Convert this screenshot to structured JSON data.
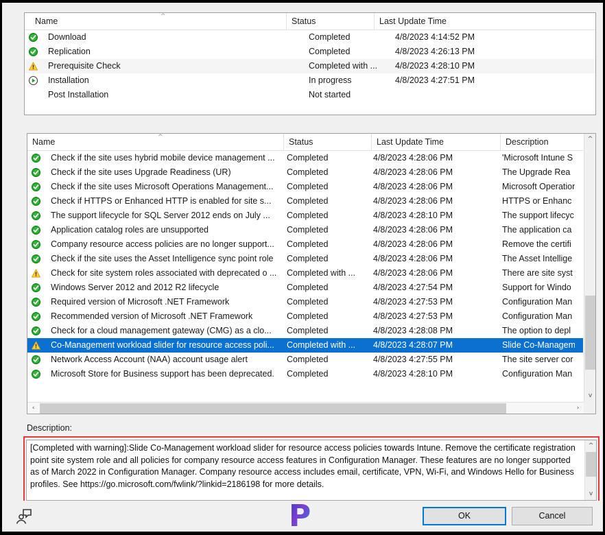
{
  "top_panel": {
    "columns": [
      "Name",
      "Status",
      "Last Update Time"
    ],
    "sort_indicator": "^",
    "rows": [
      {
        "icon": "success-icon",
        "name": "Download",
        "status": "Completed",
        "time": "4/8/2023 4:14:52 PM"
      },
      {
        "icon": "success-icon",
        "name": "Replication",
        "status": "Completed",
        "time": "4/8/2023 4:26:13 PM"
      },
      {
        "icon": "warning-icon",
        "name": "Prerequisite Check",
        "status": "Completed with ...",
        "time": "4/8/2023 4:28:10 PM"
      },
      {
        "icon": "progress-icon",
        "name": "Installation",
        "status": "In progress",
        "time": "4/8/2023 4:27:51 PM"
      },
      {
        "icon": "none",
        "name": "Post Installation",
        "status": "Not started",
        "time": ""
      }
    ]
  },
  "main_panel": {
    "columns": [
      "Name",
      "Status",
      "Last Update Time",
      "Description"
    ],
    "sort_indicator": "^",
    "rows": [
      {
        "icon": "success-icon",
        "name": "Check if the site uses hybrid mobile device management ...",
        "status": "Completed",
        "time": "4/8/2023 4:28:06 PM",
        "description": "'Microsoft Intune S"
      },
      {
        "icon": "success-icon",
        "name": "Check if the site uses Upgrade Readiness (UR)",
        "status": "Completed",
        "time": "4/8/2023 4:28:06 PM",
        "description": "The Upgrade Rea"
      },
      {
        "icon": "success-icon",
        "name": "Check if the site uses Microsoft Operations Management...",
        "status": "Completed",
        "time": "4/8/2023 4:28:06 PM",
        "description": "Microsoft Operation"
      },
      {
        "icon": "success-icon",
        "name": "Check if HTTPS or Enhanced HTTP is enabled for site s...",
        "status": "Completed",
        "time": "4/8/2023 4:28:06 PM",
        "description": "HTTPS or Enhanc"
      },
      {
        "icon": "success-icon",
        "name": "The support lifecycle for SQL Server 2012 ends on July ...",
        "status": "Completed",
        "time": "4/8/2023 4:28:10 PM",
        "description": "The support lifecyc"
      },
      {
        "icon": "success-icon",
        "name": "Application catalog roles are unsupported",
        "status": "Completed",
        "time": "4/8/2023 4:28:06 PM",
        "description": "The application ca"
      },
      {
        "icon": "success-icon",
        "name": "Company resource access policies are no longer support...",
        "status": "Completed",
        "time": "4/8/2023 4:28:06 PM",
        "description": "Remove the certifi"
      },
      {
        "icon": "success-icon",
        "name": "Check if the site uses the Asset Intelligence sync point role",
        "status": "Completed",
        "time": "4/8/2023 4:28:06 PM",
        "description": "The Asset Intellige"
      },
      {
        "icon": "warning-icon",
        "name": "Check for site system roles associated with deprecated o ...",
        "status": "Completed with ...",
        "time": "4/8/2023 4:28:06 PM",
        "description": "There are site syst"
      },
      {
        "icon": "success-icon",
        "name": "Windows Server 2012 and 2012 R2 lifecycle",
        "status": "Completed",
        "time": "4/8/2023 4:27:54 PM",
        "description": "Support for Windo"
      },
      {
        "icon": "success-icon",
        "name": "Required version of Microsoft .NET Framework",
        "status": "Completed",
        "time": "4/8/2023 4:27:53 PM",
        "description": "Configuration Man"
      },
      {
        "icon": "success-icon",
        "name": "Recommended version of Microsoft .NET Framework",
        "status": "Completed",
        "time": "4/8/2023 4:27:53 PM",
        "description": "Configuration Man"
      },
      {
        "icon": "success-icon",
        "name": "Check for a cloud management gateway (CMG) as a clo...",
        "status": "Completed",
        "time": "4/8/2023 4:28:08 PM",
        "description": "The option to depl"
      },
      {
        "icon": "warning-icon",
        "name": "Co-Management workload slider for resource access poli...",
        "status": "Completed with ...",
        "time": "4/8/2023 4:28:07 PM",
        "description": "Slide Co-Managem",
        "selected": true
      },
      {
        "icon": "success-icon",
        "name": "Network Access Account (NAA) account usage alert",
        "status": "Completed",
        "time": "4/8/2023 4:27:55 PM",
        "description": "The site server cor"
      },
      {
        "icon": "success-icon",
        "name": "Microsoft Store for Business support has been deprecated.",
        "status": "Completed",
        "time": "4/8/2023 4:28:10 PM",
        "description": "Configuration Man"
      }
    ]
  },
  "description_panel": {
    "label": "Description:",
    "text": "[Completed with warning]:Slide Co-Management workload slider for resource access policies towards Intune. Remove the certificate registration point site system role and all policies for company resource access features in Configuration Manager. These features are no longer supported as of March 2022 in Configuration Manager. Company resource access includes email, certificate, VPN, Wi-Fi, and Windows Hello for Business profiles. See https://go.microsoft.com/fwlink/?linkid=2186198 for more details."
  },
  "buttons": {
    "ok": "OK",
    "cancel": "Cancel"
  },
  "icons": {
    "feedback": "feedback-person-icon",
    "watermark": "P"
  },
  "colors": {
    "selection": "#0b71d0",
    "highlight_border": "#e8393f",
    "focus_border": "#0078d7",
    "success": "#20a020",
    "warning": "#ffc425"
  },
  "scrollbars": {
    "vertical_arrow_up": "^",
    "vertical_arrow_down": "v",
    "horizontal_arrow_left": "‹",
    "horizontal_arrow_right": "›"
  }
}
